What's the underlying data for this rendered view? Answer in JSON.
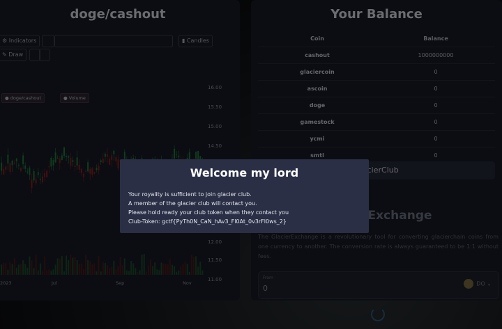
{
  "left_panel": {
    "title": "doge/cashout",
    "toolbar": {
      "indicators": "Indicators",
      "candles": "Candles",
      "draw": "Draw"
    },
    "legend": [
      "doge/cashout",
      "Volume"
    ],
    "price_ticks": [
      "16.00",
      "15.50",
      "15.00",
      "14.50",
      "12.00",
      "11.50",
      "11.00"
    ],
    "date_ticks": [
      "2023",
      "Jul",
      "Sep",
      "Nov"
    ]
  },
  "right_panel": {
    "title": "Your Balance",
    "table": {
      "headers": [
        "Coin",
        "Balance"
      ],
      "rows": [
        {
          "coin": "cashout",
          "balance": "1000000000"
        },
        {
          "coin": "glaciercoin",
          "balance": "0"
        },
        {
          "coin": "ascoin",
          "balance": "0"
        },
        {
          "coin": "doge",
          "balance": "0"
        },
        {
          "coin": "gamestock",
          "balance": "0"
        },
        {
          "coin": "ycmi",
          "balance": "0"
        },
        {
          "coin": "smtl",
          "balance": "0"
        }
      ]
    },
    "club_button": "GlacierClub",
    "exchange_title": "GlacierExchange",
    "exchange_desc": "The GlacierExchange is a revolutionary tool for converting glacierchain coins from one currency to another. The conversion rate is always guaranteed to be 1:1 without fees.",
    "from_label": "From",
    "from_value": "0",
    "from_coin": "DO"
  },
  "modal": {
    "title": "Welcome my lord",
    "lines": [
      "Your royality is sufficient to join glacier club.",
      "A member of the glacier club will contact you.",
      "Please hold ready your club token when they contact you",
      "Club-Token: gctf{PyTh0N_CaN_hAv3_Fl0At_0v3rFl0ws_2}"
    ]
  }
}
